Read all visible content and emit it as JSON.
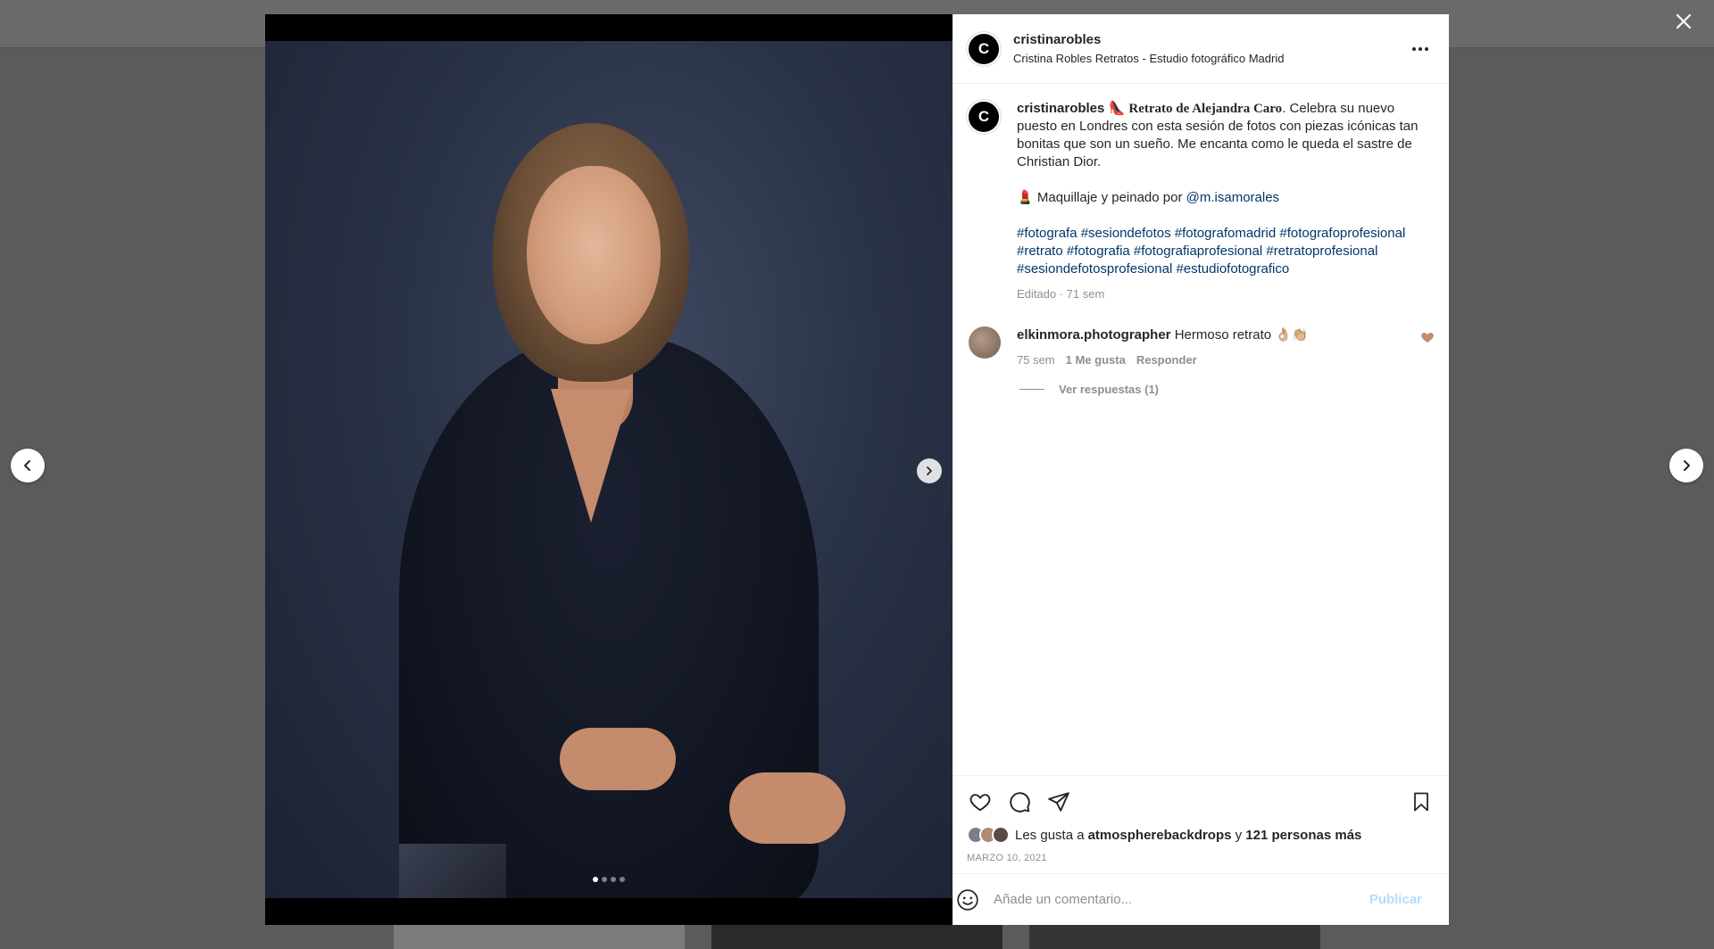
{
  "post": {
    "username": "cristinarobles",
    "subtitle": "Cristina Robles Retratos - Estudio fotográfico Madrid",
    "avatar_letter": "C",
    "more_label": "···"
  },
  "caption": {
    "username": "cristinarobles",
    "emoji": "👠",
    "title": "Retrato de Alejandra Caro",
    "text": ". Celebra su nuevo puesto en Londres con esta sesión de fotos con piezas icónicas tan bonitas que son un sueño. Me encanta como le queda el sastre de Christian Dior.",
    "credit_emoji": "💄",
    "credit_text": "Maquillaje y peinado por ",
    "credit_mention": "@m.isamorales",
    "hashtags": "#fotografa #sesiondefotos #fotografomadrid #fotografoprofesional #retrato #fotografia #fotografiaprofesional #retratoprofesional #sesiondefotosprofesional #estudiofotografico",
    "meta": "Editado · 71 sem"
  },
  "comment": {
    "username": "elkinmora.photographer",
    "text": "Hermoso retrato 👌🏼👏🏼",
    "age": "75 sem",
    "likes": "1 Me gusta",
    "reply_label": "Responder",
    "view_replies": "Ver respuestas (1)"
  },
  "likes": {
    "prefix": "Les gusta a ",
    "user": "atmospherebackdrops",
    "middle": " y ",
    "others": "121 personas más"
  },
  "date": "MARZO 10, 2021",
  "add_comment": {
    "placeholder": "Añade un comentario...",
    "publish_label": "Publicar"
  },
  "carousel": {
    "slides": 4,
    "active": 0
  },
  "colors": {
    "link": "#00376b",
    "publish_disabled": "#b2dffc",
    "like_heart": "#c48b6c"
  }
}
